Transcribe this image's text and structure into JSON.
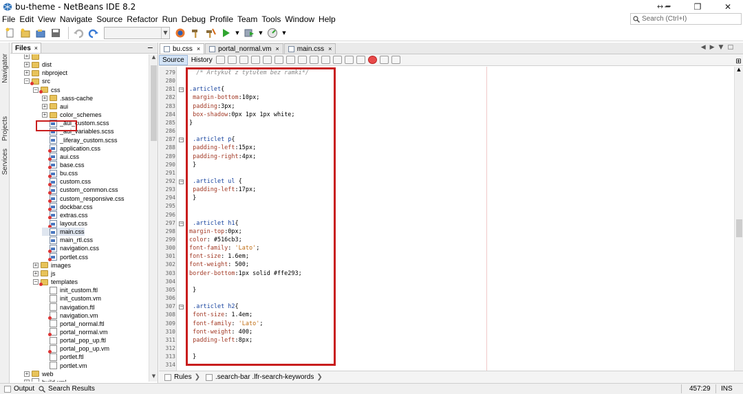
{
  "window": {
    "title": "bu-theme - NetBeans IDE 8.2",
    "extra": "↔ ━",
    "minimize": "─",
    "maximize": "❐",
    "close": "✕"
  },
  "menu": [
    "File",
    "Edit",
    "View",
    "Navigate",
    "Source",
    "Refactor",
    "Run",
    "Debug",
    "Profile",
    "Team",
    "Tools",
    "Window",
    "Help"
  ],
  "search": {
    "placeholder": "Search (Ctrl+I)"
  },
  "side_tabs": [
    "Navigator",
    "Projects",
    "Services"
  ],
  "files_panel": {
    "tab_label": "Files",
    "close": "×",
    "minimize": "−",
    "tree": [
      {
        "label": "",
        "indent": 2,
        "type": "folder",
        "exp": "+"
      },
      {
        "label": "dist",
        "indent": 2,
        "type": "folder",
        "exp": "+"
      },
      {
        "label": "nbproject",
        "indent": 2,
        "type": "folder",
        "exp": "+"
      },
      {
        "label": "src",
        "indent": 2,
        "type": "folder",
        "exp": "−",
        "err": true
      },
      {
        "label": "css",
        "indent": 3,
        "type": "folder",
        "exp": "−",
        "err": true
      },
      {
        "label": ".sass-cache",
        "indent": 4,
        "type": "folder",
        "exp": "+"
      },
      {
        "label": "aui",
        "indent": 4,
        "type": "folder",
        "exp": "+"
      },
      {
        "label": "color_schemes",
        "indent": 4,
        "type": "folder",
        "exp": "+"
      },
      {
        "label": "_aui_custom.scss",
        "indent": 4,
        "type": "css"
      },
      {
        "label": "_aui_variables.scss",
        "indent": 4,
        "type": "css"
      },
      {
        "label": "_liferay_custom.scss",
        "indent": 4,
        "type": "css"
      },
      {
        "label": "application.css",
        "indent": 4,
        "type": "css",
        "err": true
      },
      {
        "label": "aui.css",
        "indent": 4,
        "type": "css",
        "err": true
      },
      {
        "label": "base.css",
        "indent": 4,
        "type": "css",
        "err": true
      },
      {
        "label": "bu.css",
        "indent": 4,
        "type": "css",
        "err": true
      },
      {
        "label": "custom.css",
        "indent": 4,
        "type": "css",
        "err": true
      },
      {
        "label": "custom_common.css",
        "indent": 4,
        "type": "css",
        "err": true
      },
      {
        "label": "custom_responsive.css",
        "indent": 4,
        "type": "css",
        "err": true
      },
      {
        "label": "dockbar.css",
        "indent": 4,
        "type": "css",
        "err": true
      },
      {
        "label": "extras.css",
        "indent": 4,
        "type": "css",
        "err": true
      },
      {
        "label": "layout.css",
        "indent": 4,
        "type": "css",
        "err": true
      },
      {
        "label": "main.css",
        "indent": 4,
        "type": "css",
        "highlight": true
      },
      {
        "label": "main_rtl.css",
        "indent": 4,
        "type": "css"
      },
      {
        "label": "navigation.css",
        "indent": 4,
        "type": "css",
        "err": true
      },
      {
        "label": "portlet.css",
        "indent": 4,
        "type": "css",
        "err": true
      },
      {
        "label": "images",
        "indent": 3,
        "type": "folder",
        "exp": "+"
      },
      {
        "label": "js",
        "indent": 3,
        "type": "folder",
        "exp": "+"
      },
      {
        "label": "templates",
        "indent": 3,
        "type": "folder",
        "exp": "−",
        "err": true
      },
      {
        "label": "init_custom.ftl",
        "indent": 4,
        "type": "file"
      },
      {
        "label": "init_custom.vm",
        "indent": 4,
        "type": "file"
      },
      {
        "label": "navigation.ftl",
        "indent": 4,
        "type": "file"
      },
      {
        "label": "navigation.vm",
        "indent": 4,
        "type": "file",
        "err": true
      },
      {
        "label": "portal_normal.ftl",
        "indent": 4,
        "type": "file"
      },
      {
        "label": "portal_normal.vm",
        "indent": 4,
        "type": "file",
        "err": true
      },
      {
        "label": "portal_pop_up.ftl",
        "indent": 4,
        "type": "file"
      },
      {
        "label": "portal_pop_up.vm",
        "indent": 4,
        "type": "file",
        "err": true
      },
      {
        "label": "portlet.ftl",
        "indent": 4,
        "type": "file"
      },
      {
        "label": "portlet.vm",
        "indent": 4,
        "type": "file"
      },
      {
        "label": "web",
        "indent": 2,
        "type": "folder",
        "exp": "+"
      },
      {
        "label": "build.xml",
        "indent": 2,
        "type": "file",
        "exp": "+"
      }
    ]
  },
  "editor": {
    "tabs": [
      {
        "label": "bu.css",
        "active": true
      },
      {
        "label": "portal_normal.vm",
        "active": false
      },
      {
        "label": "main.css",
        "active": false
      }
    ],
    "source_label": "Source",
    "history_label": "History",
    "lines": [
      {
        "n": "279",
        "html": "  <span class='cmt'>/* Artykuł z tytułem bez ramki*/</span>"
      },
      {
        "n": "280",
        "html": ""
      },
      {
        "n": "281",
        "fold": "−",
        "html": "<span class='sel'>.articlet</span>{"
      },
      {
        "n": "282",
        "html": " <span class='prop'>margin-bottom</span>:10px;"
      },
      {
        "n": "283",
        "html": " <span class='prop'>padding</span>:3px;"
      },
      {
        "n": "284",
        "html": " <span class='prop'>box-shadow</span>:0px 1px 1px white;"
      },
      {
        "n": "285",
        "html": "}"
      },
      {
        "n": "286",
        "html": ""
      },
      {
        "n": "287",
        "fold": "−",
        "html": " <span class='sel'>.articlet p</span>{"
      },
      {
        "n": "288",
        "html": " <span class='prop'>padding-left</span>:15px;"
      },
      {
        "n": "289",
        "html": " <span class='prop'>padding-right</span>:4px;"
      },
      {
        "n": "290",
        "html": " }"
      },
      {
        "n": "291",
        "html": ""
      },
      {
        "n": "292",
        "fold": "−",
        "html": " <span class='sel'>.articlet ul</span> {"
      },
      {
        "n": "293",
        "html": " <span class='prop'>padding-left</span>:17px;"
      },
      {
        "n": "294",
        "html": " }"
      },
      {
        "n": "295",
        "html": ""
      },
      {
        "n": "296",
        "html": ""
      },
      {
        "n": "297",
        "fold": "−",
        "html": " <span class='sel'>.articlet h1</span>{"
      },
      {
        "n": "298",
        "html": "<span class='prop'>margin-top</span>:0px;"
      },
      {
        "n": "299",
        "html": "<span class='prop'>color</span>: #516cb3;"
      },
      {
        "n": "300",
        "html": "<span class='prop'>font-family</span>: <span class='str'>'Lato'</span>;"
      },
      {
        "n": "301",
        "html": "<span class='prop'>font-size</span>: 1.6em;"
      },
      {
        "n": "302",
        "html": "<span class='prop'>font-weight</span>: 500;"
      },
      {
        "n": "303",
        "html": "<span class='prop'>border-bottom</span>:1px solid #ffe293;"
      },
      {
        "n": "304",
        "html": ""
      },
      {
        "n": "305",
        "html": " }"
      },
      {
        "n": "306",
        "html": ""
      },
      {
        "n": "307",
        "fold": "−",
        "html": " <span class='sel'>.articlet h2</span>{"
      },
      {
        "n": "308",
        "html": " <span class='prop'>font-size</span>: 1.4em;"
      },
      {
        "n": "309",
        "html": " <span class='prop'>font-family</span>: <span class='str'>'Lato'</span>;"
      },
      {
        "n": "310",
        "html": " <span class='prop'>font-weight</span>: 400;"
      },
      {
        "n": "311",
        "html": " <span class='prop'>padding-left</span>:8px;"
      },
      {
        "n": "312",
        "html": ""
      },
      {
        "n": "313",
        "html": " }"
      },
      {
        "n": "314",
        "html": ""
      }
    ],
    "breadcrumb": [
      "Rules",
      ".search-bar .lfr-search-keywords"
    ]
  },
  "status": {
    "output": "Output",
    "search_results": "Search Results",
    "position": "457:29",
    "mode": "INS"
  },
  "colors": {
    "highlight_box": "#c81d1d",
    "selector": "#16429e",
    "property": "#a33b27",
    "string": "#c06d12"
  }
}
